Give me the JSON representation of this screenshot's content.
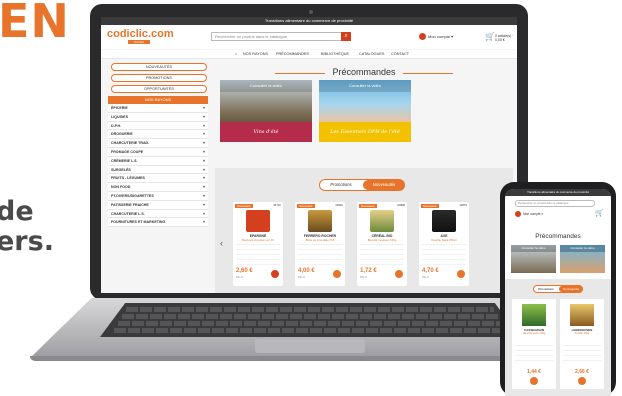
{
  "marketing": {
    "brand_word": "EN",
    "line1": "de",
    "line2": "ers."
  },
  "site": {
    "announcement": "Transitions alimentaire du commerce de proximité",
    "logo": "codiclic.com",
    "logo_sub": "Société",
    "search_placeholder": "Rechercher un produit dans le catalogue",
    "account_label": "Mon compte ▾",
    "cart_label": "0 article(s) · 0,00 €",
    "nav": [
      "NOS RAYONS",
      "PRÉCOMMANDES",
      "BIBLIOTHÈQUE",
      "CATALOGUES",
      "CONTACT"
    ]
  },
  "sidebar": {
    "pills": [
      "NOUVEAUTÉS",
      "PROMOTIONS",
      "OPPORTUNITÉS"
    ],
    "rayons_title": "NOS RAYONS",
    "categories": [
      "ÉPICERIE",
      "LIQUIDES",
      "D.P.H.",
      "DROGUERIE",
      "CHARCUTERIE TRAD.",
      "FROMAGE COUPE",
      "CRÈMERIE L.S.",
      "SURGELÉS",
      "FRUITS - LÉGUMES",
      "NON FOOD",
      "PT.DIVERS/DIGARETTES",
      "PATISSERIE FRAICHE",
      "CHARCUTERIE L.S.",
      "FOURNITURES ET MARKETING"
    ]
  },
  "main": {
    "precommandes_title": "Précommandes",
    "banners": [
      {
        "head": "Consulter la vidéo",
        "foot": "Vins d'été"
      },
      {
        "head": "Consulter la vidéo",
        "foot": "Les Essentiels DPH de l'été"
      }
    ],
    "toggle": {
      "off": "Promotions",
      "on": "Nouveautés"
    },
    "cards": [
      {
        "tag": "Nouveauté",
        "code": "0471K",
        "name": "EPARGNE",
        "desc": "Bonbons chocolat noir 10",
        "price": "2,60 €",
        "unit": "Prix U"
      },
      {
        "tag": "Nouveauté",
        "code": "0391K",
        "name": "FERRERO ROCHER",
        "desc": "Boîte de chocolats T16",
        "price": "4,00 €",
        "unit": "Prix U"
      },
      {
        "tag": "Nouveauté",
        "code": "0198M",
        "name": "CÉRÉAL BIO",
        "desc": "Biscuits moelleux 150g",
        "price": "1,72 €",
        "unit": "Prix U"
      },
      {
        "tag": "Nouveauté",
        "code": "1287S",
        "name": "AXE",
        "desc": "Douche black 250ml",
        "price": "4,70 €",
        "unit": "Prix U"
      }
    ]
  },
  "phone": {
    "announcement": "Transitions alimentaire du commerce de proximité",
    "search_placeholder": "Rechercher un produit dans le catalogue",
    "account_label": "Mon compte ▾",
    "title": "Précommandes",
    "banners": [
      {
        "head": "Consulter la vidéo"
      },
      {
        "head": "Consulter la vidéo"
      }
    ],
    "toggle": {
      "off": "Promotions",
      "on": "Nouveautés"
    },
    "cards": [
      {
        "name": "CASSEGRAIN",
        "desc": "Haricots verts 200g",
        "price": "1,44 €"
      },
      {
        "name": "LEBERHUSEN",
        "desc": "Knödel 400g",
        "price": "2,66 €"
      }
    ]
  },
  "colors": {
    "accent": "#e8742b",
    "danger": "#d43f1e",
    "banner_wine": "#b52c4a",
    "banner_yellow": "#f2c200"
  }
}
